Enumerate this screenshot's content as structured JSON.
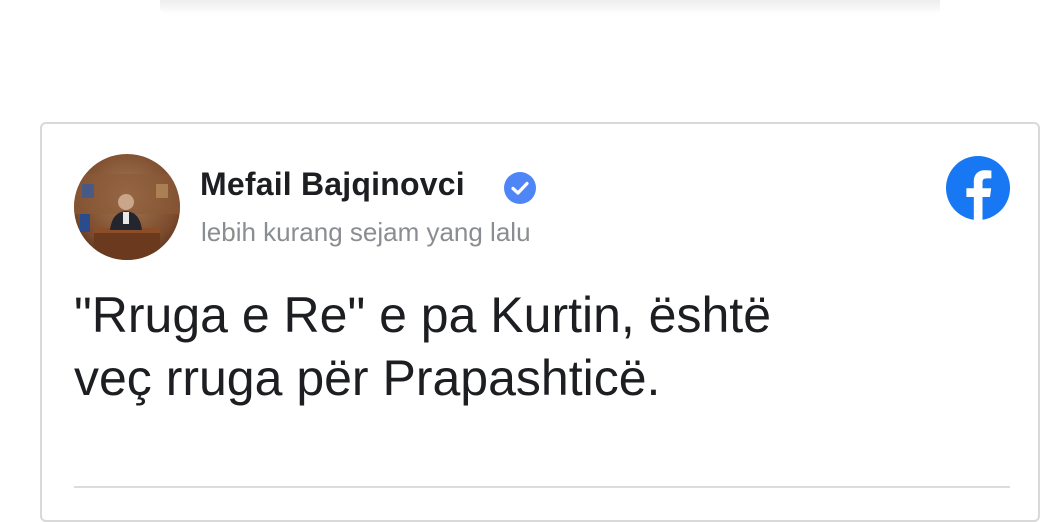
{
  "post": {
    "author": "Mefail Bajqinovci",
    "timestamp": "lebih kurang sejam yang lalu",
    "text_line1": "\"Rruga e Re\" e pa Kurtin, është",
    "text_line2": "veç rruga për Prapashticë.",
    "verified_icon": "verified-badge-icon",
    "platform_icon": "facebook-icon"
  },
  "colors": {
    "facebook_blue": "#1877f2",
    "verified_blue": "#4f86f7",
    "timestamp_gray": "#8a8d91",
    "text_dark": "#1c1e21"
  }
}
